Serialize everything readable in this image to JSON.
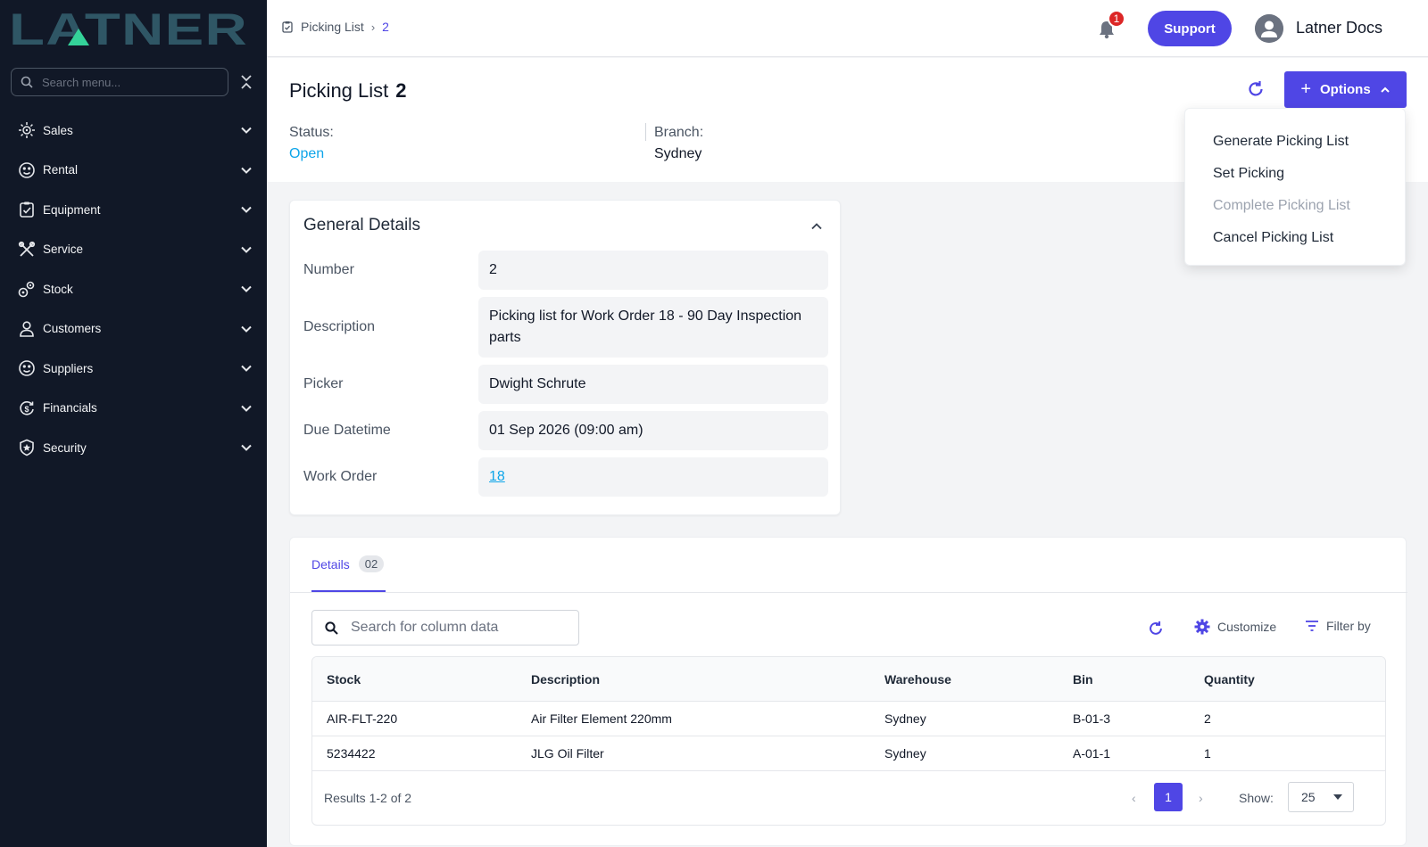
{
  "sidebar": {
    "logo_text": "LATNER",
    "search_placeholder": "Search menu...",
    "items": [
      {
        "label": "Sales",
        "icon": "sales-icon"
      },
      {
        "label": "Rental",
        "icon": "rental-icon"
      },
      {
        "label": "Equipment",
        "icon": "equipment-icon"
      },
      {
        "label": "Service",
        "icon": "service-icon"
      },
      {
        "label": "Stock",
        "icon": "stock-icon"
      },
      {
        "label": "Customers",
        "icon": "customers-icon"
      },
      {
        "label": "Suppliers",
        "icon": "suppliers-icon"
      },
      {
        "label": "Financials",
        "icon": "financials-icon"
      },
      {
        "label": "Security",
        "icon": "security-icon"
      }
    ]
  },
  "topbar": {
    "breadcrumb": {
      "root": "Picking List",
      "sep": "›",
      "current": "2"
    },
    "notification_count": "1",
    "support_label": "Support",
    "user_name": "Latner Docs"
  },
  "header": {
    "title": "Picking List",
    "number": "2",
    "status_label": "Status:",
    "status_value": "Open",
    "branch_label": "Branch:",
    "branch_value": "Sydney",
    "options_label": "Options"
  },
  "options_menu": [
    {
      "label": "Generate Picking List",
      "disabled": false
    },
    {
      "label": "Set Picking",
      "disabled": false
    },
    {
      "label": "Complete Picking List",
      "disabled": true
    },
    {
      "label": "Cancel Picking List",
      "disabled": false
    }
  ],
  "general": {
    "title": "General Details",
    "fields": [
      {
        "label": "Number",
        "value": "2"
      },
      {
        "label": "Description",
        "value": "Picking list for Work Order 18 - 90 Day Inspection parts"
      },
      {
        "label": "Picker",
        "value": "Dwight Schrute"
      },
      {
        "label": "Due Datetime",
        "value": "01 Sep 2026 (09:00 am)"
      },
      {
        "label": "Work Order",
        "value": "18"
      }
    ]
  },
  "details": {
    "tab_label": "Details",
    "tab_count": "02",
    "search_placeholder": "Search for column data",
    "customize_label": "Customize",
    "filter_label": "Filter by",
    "columns": [
      "Stock",
      "Description",
      "Warehouse",
      "Bin",
      "Quantity"
    ],
    "rows": [
      [
        "AIR-FLT-220",
        "Air Filter Element 220mm",
        "Sydney",
        "B-01-3",
        "2"
      ],
      [
        "5234422",
        "JLG Oil Filter",
        "Sydney",
        "A-01-1",
        "1"
      ]
    ],
    "results_text": "Results 1-2 of 2",
    "current_page": "1",
    "show_label": "Show:",
    "page_size": "25"
  },
  "colors": {
    "accent": "#4f46e5",
    "sidebar_bg": "#111827",
    "link": "#0ea5e9",
    "badge": "#dc2626"
  }
}
